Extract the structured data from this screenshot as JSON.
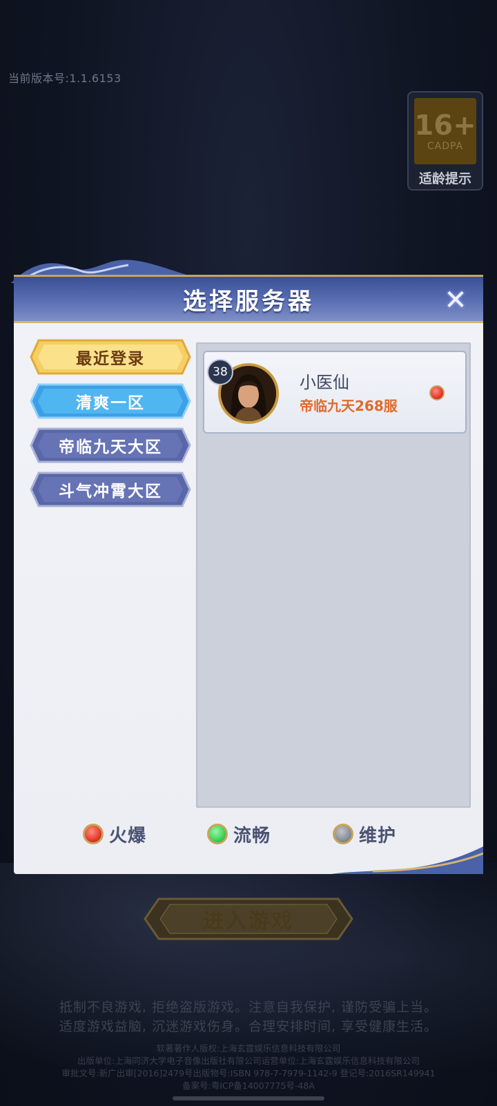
{
  "version_text": "当前版本号:1.1.6153",
  "age_rating": {
    "number": "16+",
    "org": "CADPA",
    "tip": "适龄提示"
  },
  "dialog": {
    "title": "选择服务器",
    "tabs": [
      {
        "label": "最近登录",
        "state": "selected-gold"
      },
      {
        "label": "清爽一区",
        "state": "active-blue"
      },
      {
        "label": "帝临九天大区",
        "state": "normal"
      },
      {
        "label": "斗气冲霄大区",
        "state": "normal"
      }
    ],
    "servers": [
      {
        "level": "38",
        "player_name": "小医仙",
        "server_name": "帝临九天268服",
        "status": "hot"
      }
    ],
    "legend": [
      {
        "label": "火爆",
        "color": "#e33a2c"
      },
      {
        "label": "流畅",
        "color": "#3fd15a"
      },
      {
        "label": "维护",
        "color": "#8a8e96"
      }
    ]
  },
  "enter_button": "进入游戏",
  "notice": {
    "line1": "抵制不良游戏, 拒绝盗版游戏。注意自我保护, 谨防受骗上当。",
    "line2": "适度游戏益脑, 沉迷游戏伤身。合理安排时间, 享受健康生活。"
  },
  "legal": {
    "line1": "软著著作人版权:上海玄霆娱乐信息科技有限公司",
    "line2": "出版单位:上海同济大学电子音像出版社有限公司运营单位:上海玄霆娱乐信息科技有限公司",
    "line3": "审批文号:新广出审[2016]2479号出版物号:ISBN 978-7-7979-1142-9 登记号:2016SR149941",
    "line4": "备案号:粤ICP备14007775号-48A"
  }
}
